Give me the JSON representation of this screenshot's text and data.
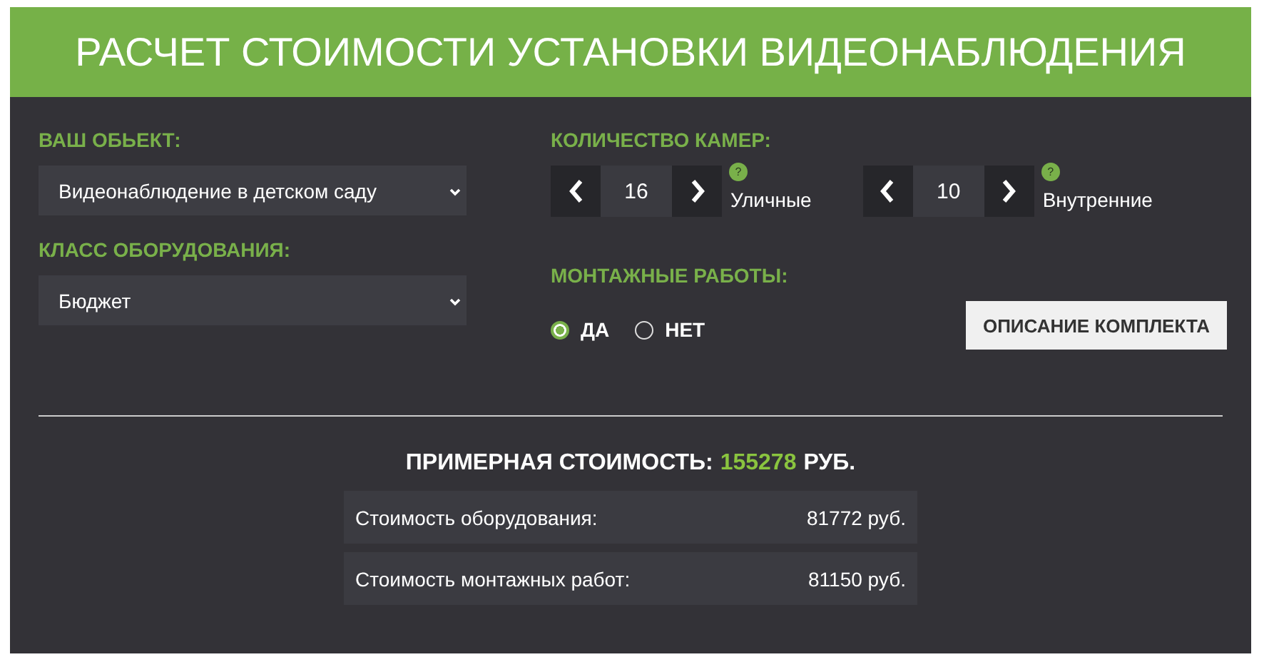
{
  "title": "РАСЧЕТ СТОИМОСТИ УСТАНОВКИ ВИДЕОНАБЛЮДЕНИЯ",
  "object": {
    "label": "ВАШ ОБЬЕКТ:",
    "value": "Видеонаблюдение в детском саду"
  },
  "equipment_class": {
    "label": "КЛАСС ОБОРУДОВАНИЯ:",
    "value": "Бюджет"
  },
  "cameras": {
    "label": "КОЛИЧЕСТВО КАМЕР:",
    "counters": [
      {
        "value": "16",
        "help": "?",
        "caption": "Уличные"
      },
      {
        "value": "10",
        "help": "?",
        "caption": "Внутренние"
      }
    ]
  },
  "installation": {
    "label": "МОНТАЖНЫЕ РАБОТЫ:",
    "options": [
      {
        "label": "ДА",
        "selected": true
      },
      {
        "label": "НЕТ",
        "selected": false
      }
    ]
  },
  "kit_button": "ОПИСАНИЕ КОМПЛЕКТА",
  "total": {
    "label": "ПРИМЕРНАЯ СТОИМОСТЬ:",
    "value": "155278",
    "unit": "РУБ."
  },
  "breakdown": [
    {
      "label": "Стоимость оборудования:",
      "value": "81772 руб."
    },
    {
      "label": "Стоимость монтажных работ:",
      "value": "81150 руб."
    }
  ]
}
